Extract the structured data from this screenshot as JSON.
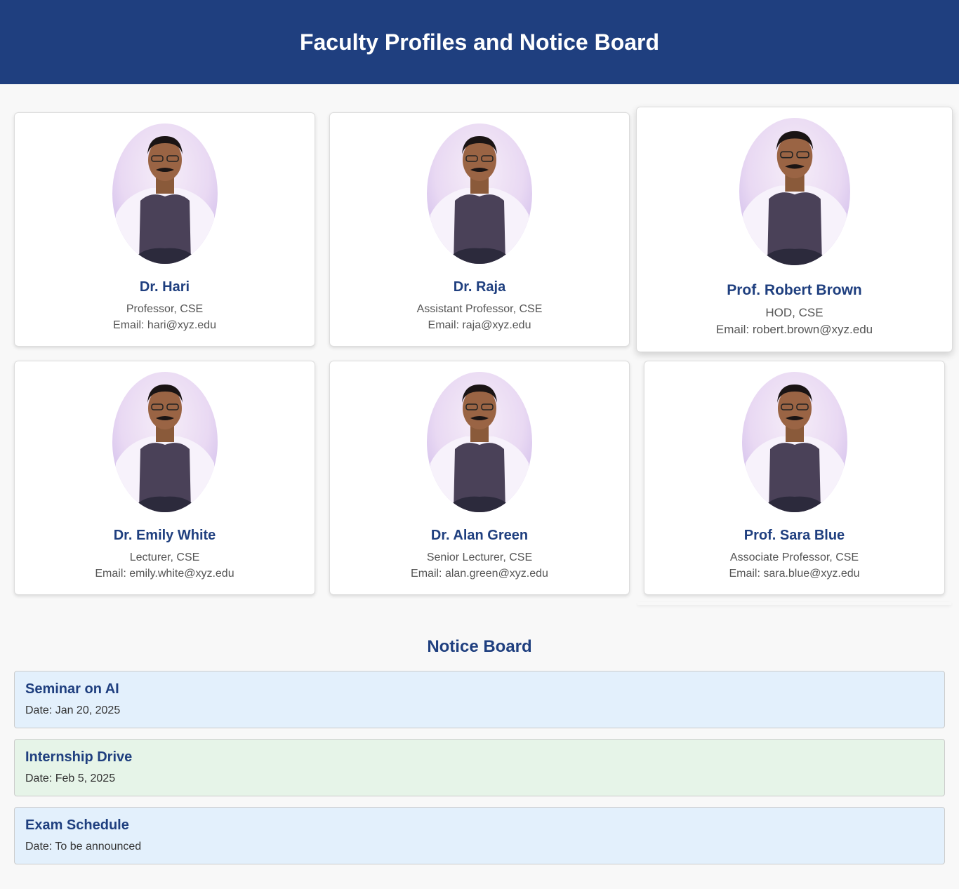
{
  "header": {
    "title": "Faculty Profiles and Notice Board"
  },
  "faculty": [
    {
      "name": "Dr. Hari",
      "role": "Professor, CSE",
      "email": "Email: hari@xyz.edu"
    },
    {
      "name": "Dr. Raja",
      "role": "Assistant Professor, CSE",
      "email": "Email: raja@xyz.edu"
    },
    {
      "name": "Prof. Robert Brown",
      "role": "HOD, CSE",
      "email": "Email: robert.brown@xyz.edu"
    },
    {
      "name": "Dr. Emily White",
      "role": "Lecturer, CSE",
      "email": "Email: emily.white@xyz.edu"
    },
    {
      "name": "Dr. Alan Green",
      "role": "Senior Lecturer, CSE",
      "email": "Email: alan.green@xyz.edu"
    },
    {
      "name": "Prof. Sara Blue",
      "role": "Associate Professor, CSE",
      "email": "Email: sara.blue@xyz.edu"
    }
  ],
  "notice_board": {
    "heading": "Notice Board",
    "items": [
      {
        "title": "Seminar on AI",
        "date": "Date: Jan 20, 2025",
        "color": "#e3f0fc"
      },
      {
        "title": "Internship Drive",
        "date": "Date: Feb 5, 2025",
        "color": "#e6f4e8"
      },
      {
        "title": "Exam Schedule",
        "date": "Date: To be announced",
        "color": "#e3f0fc"
      }
    ]
  },
  "colors": {
    "header_bg": "#1f3f7f",
    "accent": "#1f3f7f",
    "page_bg": "#f8f8f8"
  }
}
